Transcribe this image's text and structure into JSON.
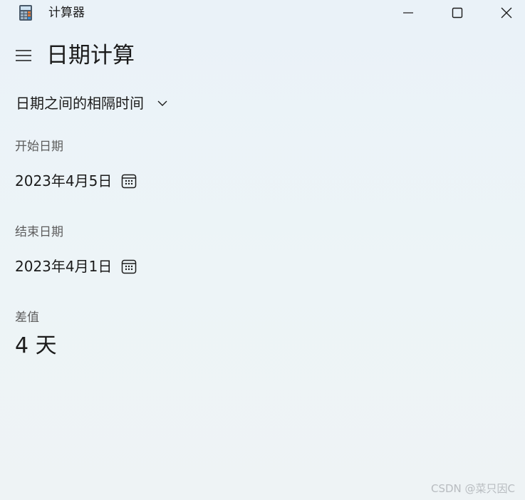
{
  "window": {
    "title": "计算器",
    "app_icon": "calculator-icon",
    "controls": [
      "minimize-icon",
      "maximize-icon",
      "close-icon"
    ]
  },
  "header": {
    "menu_icon": "hamburger-icon",
    "page_title": "日期计算"
  },
  "mode": {
    "selected": "日期之间的相隔时间",
    "icon": "chevron-down-icon"
  },
  "start": {
    "label": "开始日期",
    "value": "2023年4月5日",
    "icon": "calendar-icon"
  },
  "end": {
    "label": "结束日期",
    "value": "2023年4月1日",
    "icon": "calendar-icon"
  },
  "result": {
    "label": "差值",
    "value": "4 天"
  },
  "watermark": "CSDN @菜只因C",
  "colors": {
    "background": "#eaf2f8",
    "text_primary": "#1b1b1b",
    "text_secondary": "#5d5d5d"
  }
}
